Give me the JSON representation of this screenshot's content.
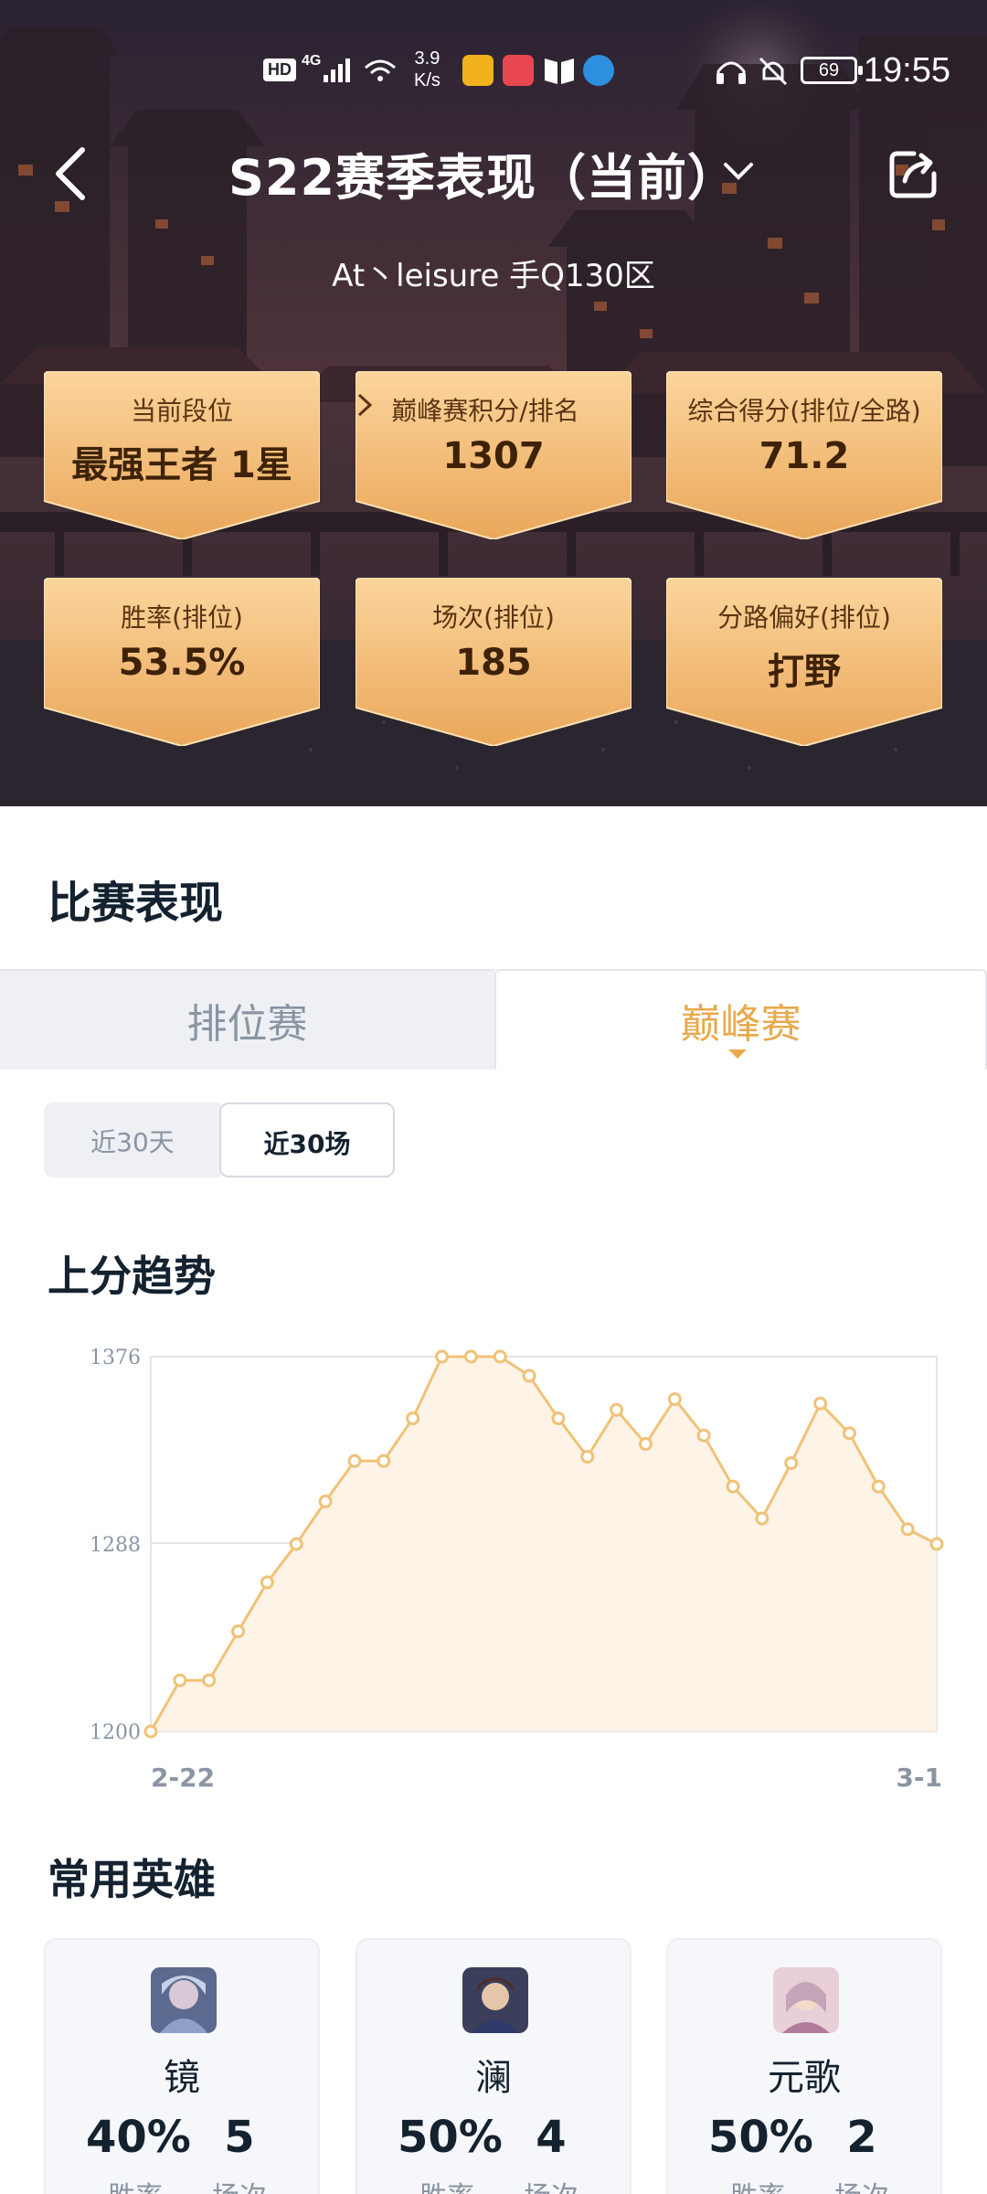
{
  "status_bar": {
    "time": "19:55",
    "net_speed_value": "3.9",
    "net_speed_unit": "K/s",
    "hd_badge": "HD",
    "network_type": "4G",
    "battery": "69"
  },
  "header": {
    "title": "S22赛季表现（当前）",
    "player_line": "At丶leisure  手Q130区"
  },
  "stats": [
    {
      "label": "当前段位",
      "value": "最强王者 1星"
    },
    {
      "label": "巅峰赛积分/排名",
      "value": "1307"
    },
    {
      "label": "综合得分(排位/全路)",
      "value": "71.2"
    },
    {
      "label": "胜率(排位)",
      "value": "53.5%"
    },
    {
      "label": "场次(排位)",
      "value": "185"
    },
    {
      "label": "分路偏好(排位)",
      "value": "打野"
    }
  ],
  "match_section": {
    "title": "比赛表现",
    "tabs": [
      "排位赛",
      "巅峰赛"
    ],
    "active_tab": "巅峰赛",
    "ranges": [
      "近30天",
      "近30场"
    ],
    "active_range": "近30场"
  },
  "trend": {
    "title": "上分趋势"
  },
  "chart_data": {
    "type": "area",
    "title": "上分趋势",
    "xlabel": "",
    "ylabel": "",
    "y_ticks": [
      "1376",
      "1288",
      "1200"
    ],
    "ylim": [
      1200,
      1376
    ],
    "x_tick_labels": [
      "2-22",
      "3-1"
    ],
    "grid": "horizontal at 1288",
    "color": "#f0c277",
    "fill": "#fdf3e7",
    "values": [
      1200,
      1224,
      1224,
      1247,
      1270,
      1288,
      1308,
      1327,
      1327,
      1347,
      1376,
      1376,
      1376,
      1367,
      1347,
      1329,
      1351,
      1335,
      1356,
      1339,
      1315,
      1300,
      1326,
      1354,
      1340,
      1315,
      1295,
      1288
    ]
  },
  "common_heroes": {
    "title": "常用英雄",
    "heroes": [
      {
        "name": "镜",
        "winrate": "40%",
        "games": "5",
        "winrate_label": "胜率",
        "games_label": "场次"
      },
      {
        "name": "澜",
        "winrate": "50%",
        "games": "4",
        "winrate_label": "胜率",
        "games_label": "场次"
      },
      {
        "name": "元歌",
        "winrate": "50%",
        "games": "2",
        "winrate_label": "胜率",
        "games_label": "场次"
      }
    ]
  },
  "colors": {
    "accent": "#e8a94c",
    "tile": "#f5c27f",
    "text_dark": "#142230",
    "text_muted": "#8a95a3"
  }
}
